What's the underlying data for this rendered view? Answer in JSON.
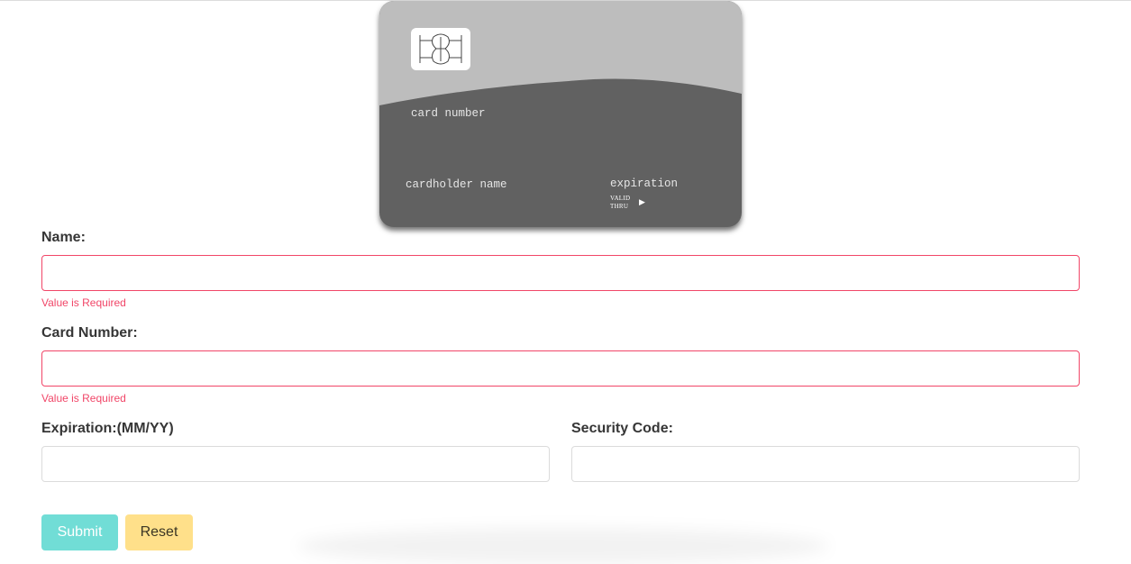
{
  "card": {
    "number_placeholder": "card number",
    "holder_placeholder": "cardholder name",
    "expiration_placeholder": "expiration",
    "valid_thru_line1": "VALID",
    "valid_thru_line2": "THRU",
    "valid_thru_arrow": "▶",
    "chip_icon": "card-chip-icon",
    "colors": {
      "card_top": "#bdbdbd",
      "card_body": "#616161",
      "card_text": "#e6e6e6"
    }
  },
  "form": {
    "name": {
      "label": "Name:",
      "value": "",
      "error": "Value is Required"
    },
    "card_number": {
      "label": "Card Number:",
      "value": "",
      "error": "Value is Required"
    },
    "expiration": {
      "label": "Expiration:(MM/YY)",
      "value": ""
    },
    "security_code": {
      "label": "Security Code:",
      "value": ""
    },
    "submit_label": "Submit",
    "reset_label": "Reset",
    "colors": {
      "error": "#f14668",
      "submit": "#71ddd6",
      "reset": "#ffe08a"
    }
  }
}
